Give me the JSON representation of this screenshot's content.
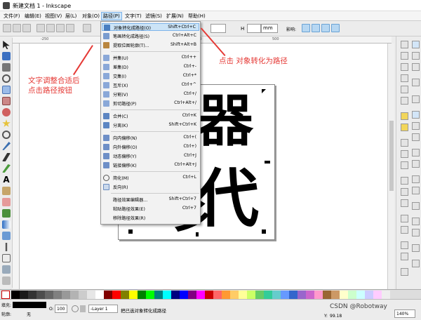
{
  "window": {
    "title": "新建文档 1 - Inkscape"
  },
  "menubar": {
    "items": [
      "文件(F)",
      "编辑(E)",
      "视图(V)",
      "层(L)",
      "对象(O)",
      "路径(P)",
      "文字(T)",
      "滤镜(S)",
      "扩展(N)",
      "帮助(H)"
    ],
    "active_index": 5
  },
  "toolbar": {
    "width_value": "",
    "height_label": "H",
    "height_value": "",
    "unit": "mm",
    "transform_label": "影响:"
  },
  "path_menu": {
    "items": [
      {
        "label": "对象转化成路径(O)",
        "shortcut": "Shift+Ctrl+C",
        "icon": "object-to-path-icon",
        "highlighted": true
      },
      {
        "label": "笔画转化成路径(S)",
        "shortcut": "Ctrl+Alt+C",
        "icon": "stroke-to-path-icon"
      },
      {
        "label": "提取位图轮廓(T)...",
        "shortcut": "Shift+Alt+B",
        "icon": "trace-bitmap-icon"
      },
      {
        "label": "并集(U)",
        "shortcut": "Ctrl++",
        "icon": "union-icon"
      },
      {
        "label": "差集(D)",
        "shortcut": "Ctrl+-",
        "icon": "difference-icon"
      },
      {
        "label": "交集(I)",
        "shortcut": "Ctrl+*",
        "icon": "intersection-icon"
      },
      {
        "label": "互斥(X)",
        "shortcut": "Ctrl+^",
        "icon": "exclusion-icon"
      },
      {
        "label": "分割(V)",
        "shortcut": "Ctrl+/",
        "icon": "division-icon"
      },
      {
        "label": "剪切路径(P)",
        "shortcut": "Ctrl+Alt+/",
        "icon": "cut-path-icon"
      },
      {
        "label": "合并(C)",
        "shortcut": "Ctrl+K",
        "icon": "combine-icon"
      },
      {
        "label": "分离(K)",
        "shortcut": "Shift+Ctrl+K",
        "icon": "break-apart-icon"
      },
      {
        "label": "向内偏移(N)",
        "shortcut": "Ctrl+(",
        "icon": "inset-icon"
      },
      {
        "label": "向外偏移(O)",
        "shortcut": "Ctrl+)",
        "icon": "outset-icon"
      },
      {
        "label": "动态偏移(Y)",
        "shortcut": "Ctrl+J",
        "icon": "dynamic-offset-icon"
      },
      {
        "label": "链接偏移(K)",
        "shortcut": "Ctrl+Alt+J",
        "icon": "linked-offset-icon"
      },
      {
        "label": "简化(M)",
        "shortcut": "Ctrl+L",
        "icon": "simplify-icon"
      },
      {
        "label": "反向(R)",
        "shortcut": "",
        "icon": "reverse-icon"
      },
      {
        "label": "路径效果编辑器...",
        "shortcut": "Shift+Ctrl+7",
        "icon": ""
      },
      {
        "label": "粘贴路径效果(E)",
        "shortcut": "Ctrl+7",
        "icon": ""
      },
      {
        "label": "移除路径效果(R)",
        "shortcut": "",
        "icon": ""
      }
    ]
  },
  "canvas": {
    "glyph_top": "器",
    "glyph_bottom": "代",
    "partial_glyph": "彡"
  },
  "annotations": {
    "left_line1": "文字调整合适后",
    "left_line2": "点击路径按钮",
    "right": "点击 对象转化为路径",
    "color": "#e53935"
  },
  "statusbar": {
    "fill_label": "填充:",
    "stroke_label": "轮廓:",
    "stroke_value": "无",
    "opacity_label": "O:",
    "opacity_value": "100",
    "layer_value": "-Layer 1",
    "message": "把已选对象转化成路径",
    "x_label": "X:",
    "y_label": "Y:",
    "y_value": "99.18",
    "zoom_value": "140%"
  },
  "watermark": "CSDN @Robotway"
}
